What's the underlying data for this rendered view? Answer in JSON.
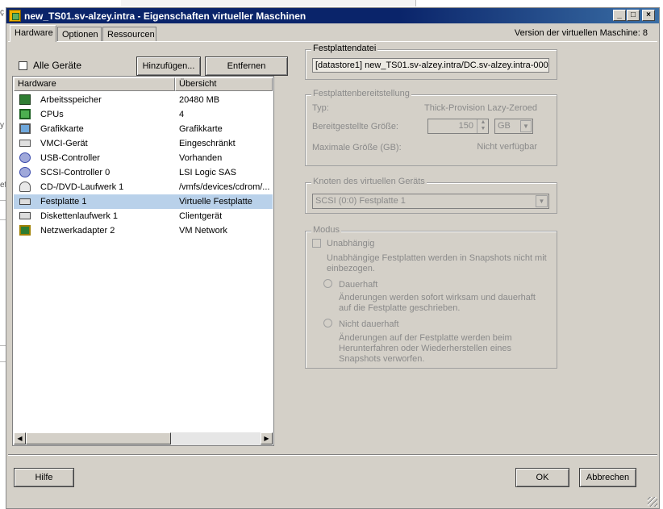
{
  "window": {
    "title": "new_TS01.sv-alzey.intra - Eigenschaften virtueller Maschinen",
    "buttons": {
      "minimize": "_",
      "maximize": "□",
      "close": "×"
    }
  },
  "tabs": [
    {
      "label": "Hardware",
      "active": true
    },
    {
      "label": "Optionen",
      "active": false
    },
    {
      "label": "Ressourcen",
      "active": false
    }
  ],
  "version_label": "Version der virtuellen Maschine: 8",
  "all_devices_label": "Alle Geräte",
  "add_button": "Hinzufügen...",
  "remove_button": "Entfernen",
  "hardware_list": {
    "headers": [
      "Hardware",
      "Übersicht"
    ],
    "rows": [
      {
        "icon": "memory-icon",
        "name": "Arbeitsspeicher",
        "summary": "20480 MB"
      },
      {
        "icon": "cpu-icon",
        "name": "CPUs",
        "summary": "4"
      },
      {
        "icon": "display-icon",
        "name": "Grafikkarte",
        "summary": "Grafikkarte"
      },
      {
        "icon": "vmci-icon",
        "name": "VMCI-Gerät",
        "summary": "Eingeschränkt"
      },
      {
        "icon": "usb-icon",
        "name": "USB-Controller",
        "summary": "Vorhanden"
      },
      {
        "icon": "scsi-icon",
        "name": "SCSI-Controller 0",
        "summary": "LSI Logic SAS"
      },
      {
        "icon": "cd-dvd-icon",
        "name": "CD-/DVD-Laufwerk 1",
        "summary": "/vmfs/devices/cdrom/..."
      },
      {
        "icon": "harddisk-icon",
        "name": "Festplatte 1",
        "summary": "Virtuelle Festplatte",
        "selected": true
      },
      {
        "icon": "floppy-icon",
        "name": "Diskettenlaufwerk 1",
        "summary": "Clientgerät"
      },
      {
        "icon": "network-icon",
        "name": "Netzwerkadapter 2",
        "summary": "VM Network"
      }
    ]
  },
  "disk_file": {
    "title": "Festplattendatei",
    "value": "[datastore1] new_TS01.sv-alzey.intra/DC.sv-alzey.intra-000"
  },
  "provisioning": {
    "title": "Festplattenbereitstellung",
    "type_label": "Typ:",
    "type_value": "Thick-Provision Lazy-Zeroed",
    "size_label": "Bereitgestellte Größe:",
    "size_value": "150",
    "size_unit": "GB",
    "max_label": "Maximale Größe (GB):",
    "max_value": "Nicht verfügbar"
  },
  "virtual_device_node": {
    "title": "Knoten des virtuellen Geräts",
    "value": "SCSI (0:0) Festplatte 1"
  },
  "mode": {
    "title": "Modus",
    "independent_label": "Unabhängig",
    "independent_desc": "Unabhängige Festplatten werden in Snapshots nicht mit einbezogen.",
    "persistent_label": "Dauerhaft",
    "persistent_desc": "Änderungen werden sofort wirksam und dauerhaft auf die Festplatte geschrieben.",
    "nonpersistent_label": "Nicht dauerhaft",
    "nonpersistent_desc": "Änderungen auf der Festplatte werden beim Herunterfahren oder Wiederherstellen eines Snapshots verworfen."
  },
  "footer": {
    "help_button": "Hilfe",
    "ok_button": "OK",
    "cancel_button": "Abbrechen"
  },
  "background_left_chars": [
    "ç",
    "y",
    "ef"
  ]
}
